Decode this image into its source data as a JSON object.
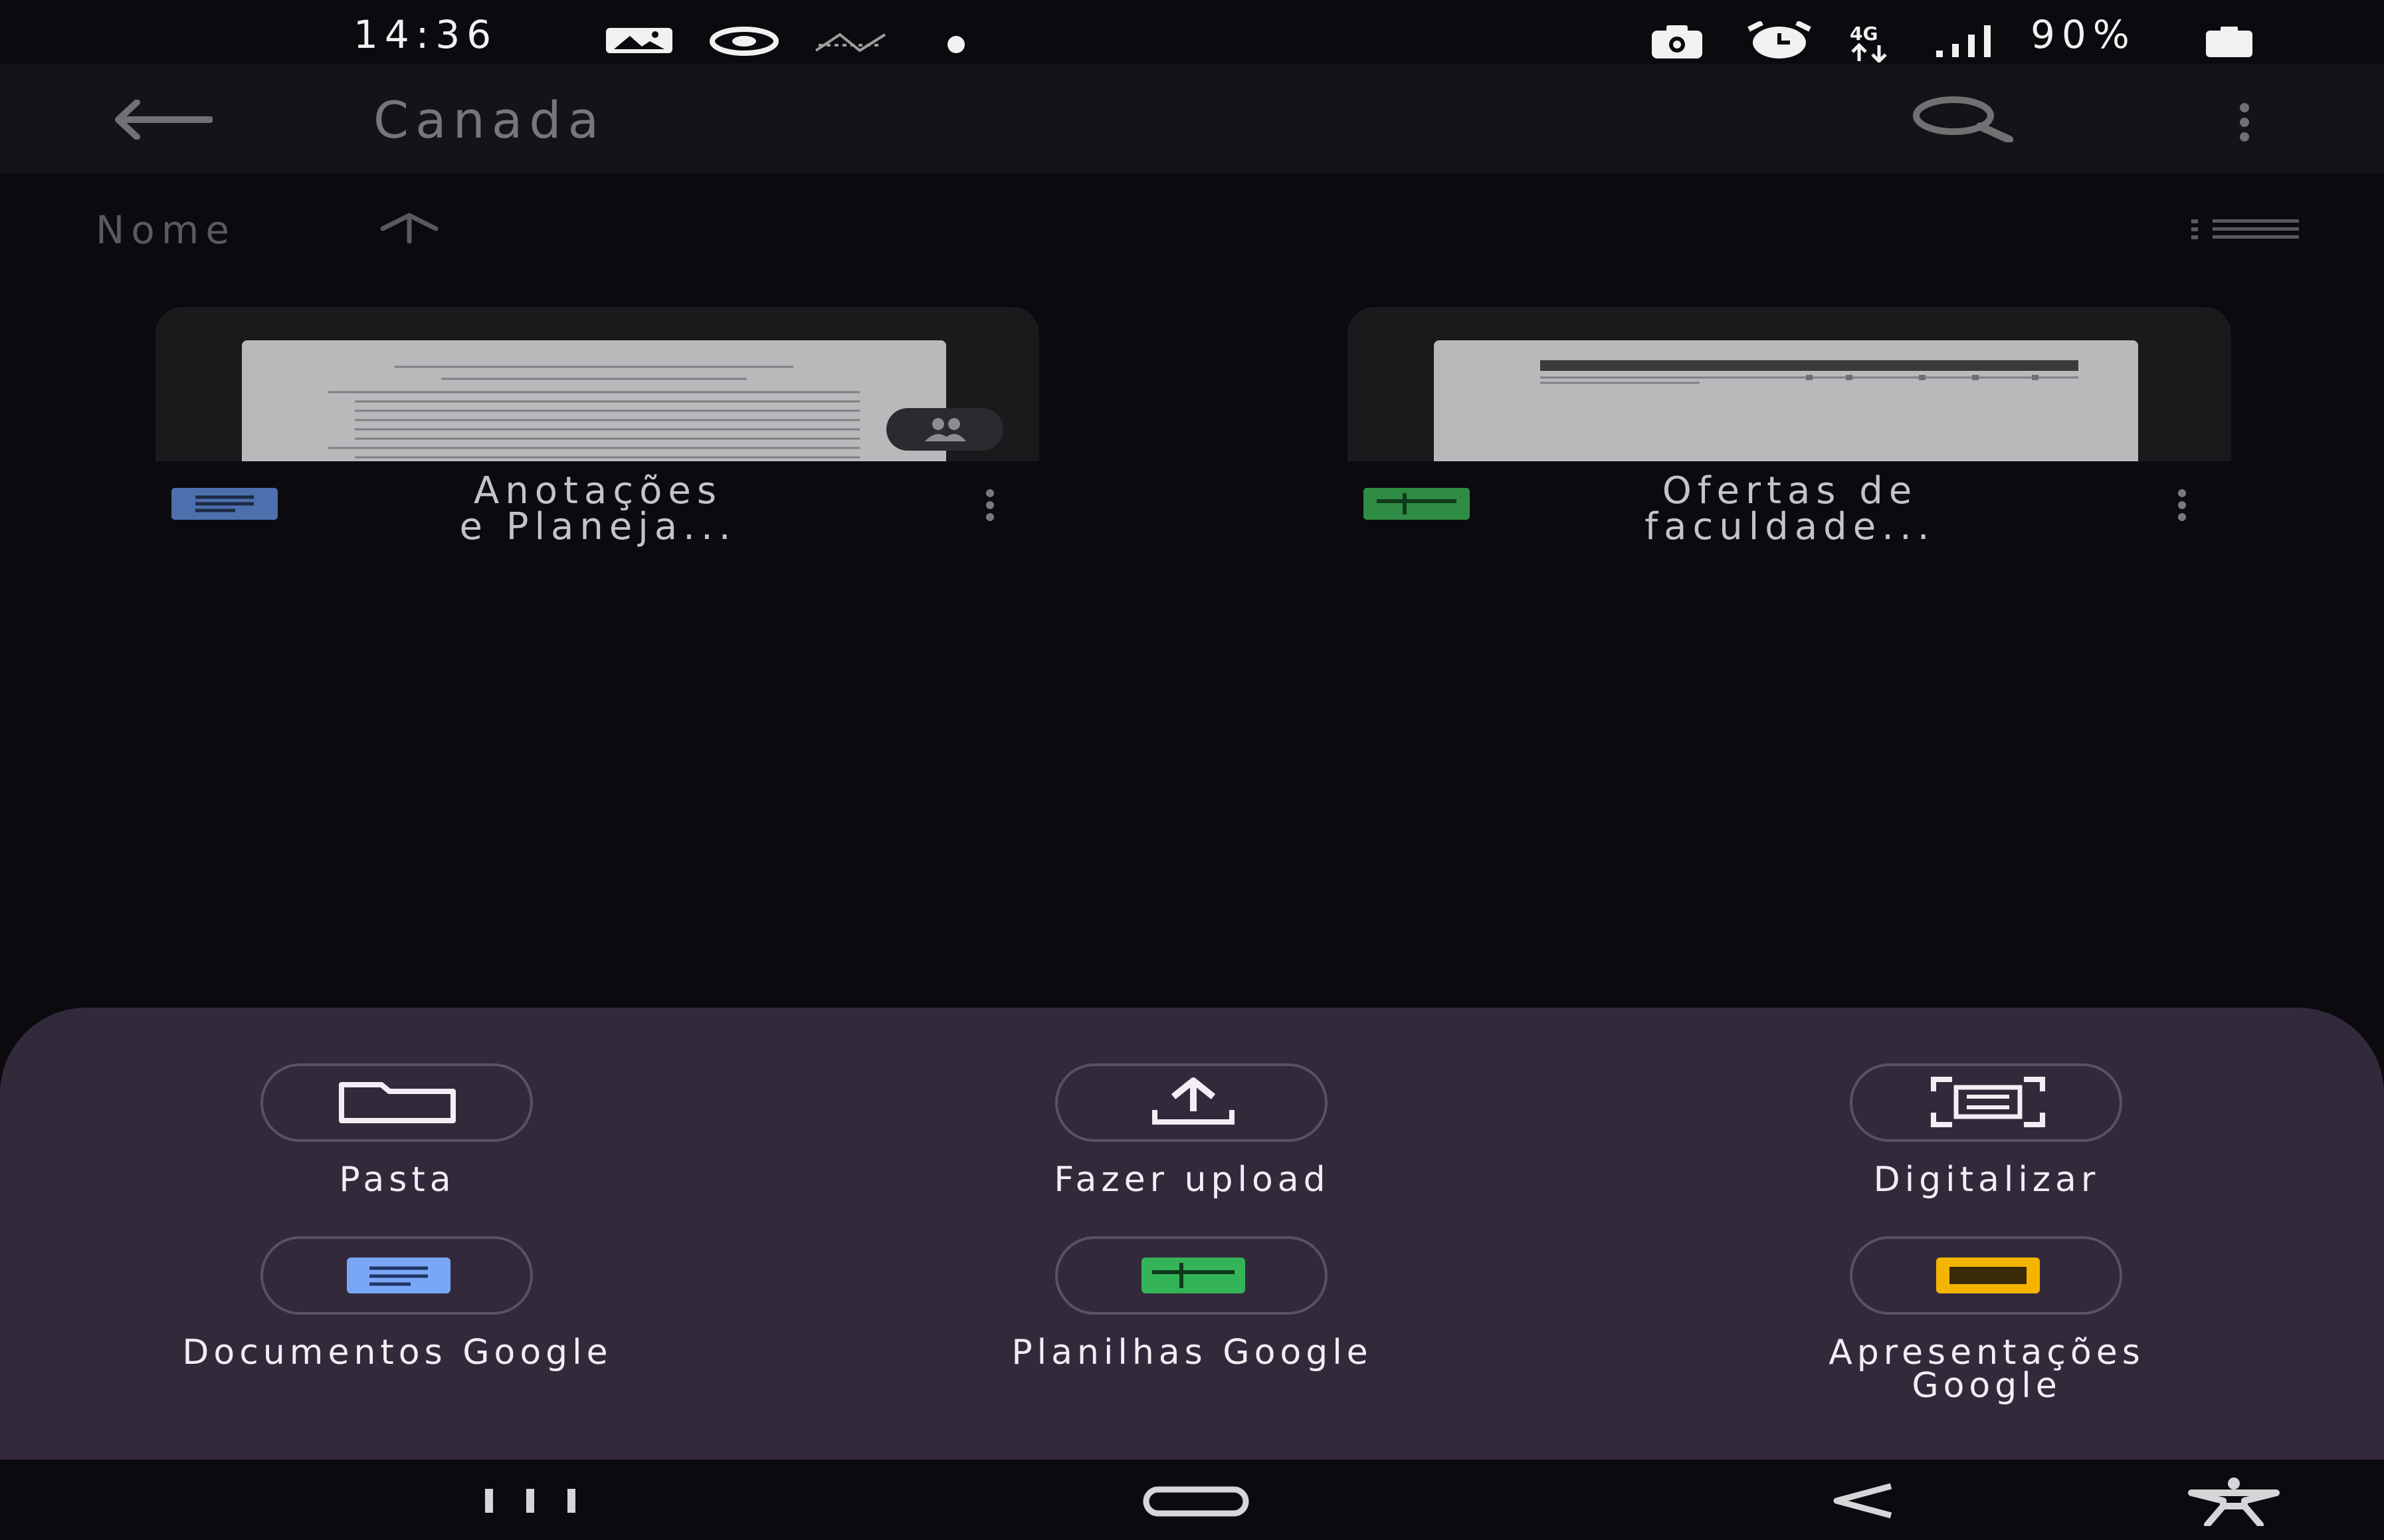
{
  "status_bar": {
    "time": "14:36",
    "battery": "90%",
    "network": "4G",
    "icons_left": [
      "gallery-icon",
      "sync-icon",
      "signal-blocked-icon",
      "dot-icon"
    ],
    "icons_right": [
      "camera-icon",
      "alarm-icon",
      "data-arrows-icon",
      "signal-icon",
      "battery-icon"
    ]
  },
  "app_bar": {
    "title": "Canada",
    "back_icon": "arrow-left-icon",
    "search_icon": "search-icon",
    "menu_icon": "more-vert-icon"
  },
  "sort": {
    "label": "Nome",
    "direction_icon": "arrow-up-icon",
    "view_icon": "list-view-icon"
  },
  "files": [
    {
      "title_line1": "Anotações",
      "title_line2": "e Planeja...",
      "type": "docs",
      "color": "#4d6fae",
      "shared": true
    },
    {
      "title_line1": "Ofertas de",
      "title_line2": "faculdade...",
      "type": "sheets",
      "color": "#2f8c44",
      "shared": false
    }
  ],
  "new_menu": {
    "actions": [
      {
        "label": "Pasta",
        "icon": "folder-icon"
      },
      {
        "label": "Fazer upload",
        "icon": "upload-icon"
      },
      {
        "label": "Digitalizar",
        "icon": "scan-icon"
      },
      {
        "label": "Documentos Google",
        "icon": "google-docs-icon",
        "color": "#7aa7f5"
      },
      {
        "label": "Planilhas Google",
        "icon": "google-sheets-icon",
        "color": "#34b359"
      },
      {
        "label": "Apresentações",
        "label_line2": "Google",
        "icon": "google-slides-icon",
        "color": "#f4b400"
      }
    ]
  },
  "nav_bar": {
    "recents_icon": "recents-icon",
    "home_icon": "home-icon",
    "back_icon": "back-chevron-icon",
    "accessibility_icon": "accessibility-icon"
  }
}
